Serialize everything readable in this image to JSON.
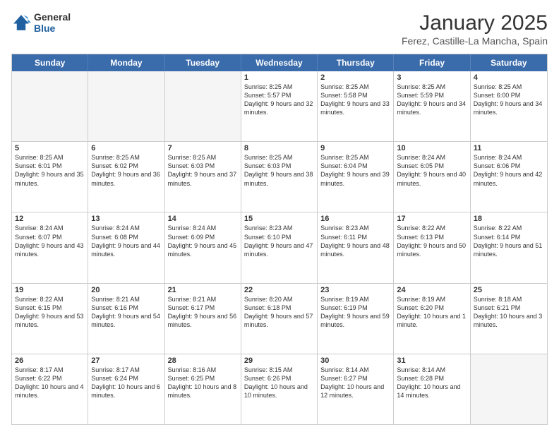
{
  "header": {
    "logo_general": "General",
    "logo_blue": "Blue",
    "month_title": "January 2025",
    "subtitle": "Ferez, Castille-La Mancha, Spain"
  },
  "days_of_week": [
    "Sunday",
    "Monday",
    "Tuesday",
    "Wednesday",
    "Thursday",
    "Friday",
    "Saturday"
  ],
  "rows": [
    [
      {
        "day": "",
        "sunrise": "",
        "sunset": "",
        "daylight": "",
        "empty": true
      },
      {
        "day": "",
        "sunrise": "",
        "sunset": "",
        "daylight": "",
        "empty": true
      },
      {
        "day": "",
        "sunrise": "",
        "sunset": "",
        "daylight": "",
        "empty": true
      },
      {
        "day": "1",
        "sunrise": "Sunrise: 8:25 AM",
        "sunset": "Sunset: 5:57 PM",
        "daylight": "Daylight: 9 hours and 32 minutes."
      },
      {
        "day": "2",
        "sunrise": "Sunrise: 8:25 AM",
        "sunset": "Sunset: 5:58 PM",
        "daylight": "Daylight: 9 hours and 33 minutes."
      },
      {
        "day": "3",
        "sunrise": "Sunrise: 8:25 AM",
        "sunset": "Sunset: 5:59 PM",
        "daylight": "Daylight: 9 hours and 34 minutes."
      },
      {
        "day": "4",
        "sunrise": "Sunrise: 8:25 AM",
        "sunset": "Sunset: 6:00 PM",
        "daylight": "Daylight: 9 hours and 34 minutes."
      }
    ],
    [
      {
        "day": "5",
        "sunrise": "Sunrise: 8:25 AM",
        "sunset": "Sunset: 6:01 PM",
        "daylight": "Daylight: 9 hours and 35 minutes."
      },
      {
        "day": "6",
        "sunrise": "Sunrise: 8:25 AM",
        "sunset": "Sunset: 6:02 PM",
        "daylight": "Daylight: 9 hours and 36 minutes."
      },
      {
        "day": "7",
        "sunrise": "Sunrise: 8:25 AM",
        "sunset": "Sunset: 6:03 PM",
        "daylight": "Daylight: 9 hours and 37 minutes."
      },
      {
        "day": "8",
        "sunrise": "Sunrise: 8:25 AM",
        "sunset": "Sunset: 6:03 PM",
        "daylight": "Daylight: 9 hours and 38 minutes."
      },
      {
        "day": "9",
        "sunrise": "Sunrise: 8:25 AM",
        "sunset": "Sunset: 6:04 PM",
        "daylight": "Daylight: 9 hours and 39 minutes."
      },
      {
        "day": "10",
        "sunrise": "Sunrise: 8:24 AM",
        "sunset": "Sunset: 6:05 PM",
        "daylight": "Daylight: 9 hours and 40 minutes."
      },
      {
        "day": "11",
        "sunrise": "Sunrise: 8:24 AM",
        "sunset": "Sunset: 6:06 PM",
        "daylight": "Daylight: 9 hours and 42 minutes."
      }
    ],
    [
      {
        "day": "12",
        "sunrise": "Sunrise: 8:24 AM",
        "sunset": "Sunset: 6:07 PM",
        "daylight": "Daylight: 9 hours and 43 minutes."
      },
      {
        "day": "13",
        "sunrise": "Sunrise: 8:24 AM",
        "sunset": "Sunset: 6:08 PM",
        "daylight": "Daylight: 9 hours and 44 minutes."
      },
      {
        "day": "14",
        "sunrise": "Sunrise: 8:24 AM",
        "sunset": "Sunset: 6:09 PM",
        "daylight": "Daylight: 9 hours and 45 minutes."
      },
      {
        "day": "15",
        "sunrise": "Sunrise: 8:23 AM",
        "sunset": "Sunset: 6:10 PM",
        "daylight": "Daylight: 9 hours and 47 minutes."
      },
      {
        "day": "16",
        "sunrise": "Sunrise: 8:23 AM",
        "sunset": "Sunset: 6:11 PM",
        "daylight": "Daylight: 9 hours and 48 minutes."
      },
      {
        "day": "17",
        "sunrise": "Sunrise: 8:22 AM",
        "sunset": "Sunset: 6:13 PM",
        "daylight": "Daylight: 9 hours and 50 minutes."
      },
      {
        "day": "18",
        "sunrise": "Sunrise: 8:22 AM",
        "sunset": "Sunset: 6:14 PM",
        "daylight": "Daylight: 9 hours and 51 minutes."
      }
    ],
    [
      {
        "day": "19",
        "sunrise": "Sunrise: 8:22 AM",
        "sunset": "Sunset: 6:15 PM",
        "daylight": "Daylight: 9 hours and 53 minutes."
      },
      {
        "day": "20",
        "sunrise": "Sunrise: 8:21 AM",
        "sunset": "Sunset: 6:16 PM",
        "daylight": "Daylight: 9 hours and 54 minutes."
      },
      {
        "day": "21",
        "sunrise": "Sunrise: 8:21 AM",
        "sunset": "Sunset: 6:17 PM",
        "daylight": "Daylight: 9 hours and 56 minutes."
      },
      {
        "day": "22",
        "sunrise": "Sunrise: 8:20 AM",
        "sunset": "Sunset: 6:18 PM",
        "daylight": "Daylight: 9 hours and 57 minutes."
      },
      {
        "day": "23",
        "sunrise": "Sunrise: 8:19 AM",
        "sunset": "Sunset: 6:19 PM",
        "daylight": "Daylight: 9 hours and 59 minutes."
      },
      {
        "day": "24",
        "sunrise": "Sunrise: 8:19 AM",
        "sunset": "Sunset: 6:20 PM",
        "daylight": "Daylight: 10 hours and 1 minute."
      },
      {
        "day": "25",
        "sunrise": "Sunrise: 8:18 AM",
        "sunset": "Sunset: 6:21 PM",
        "daylight": "Daylight: 10 hours and 3 minutes."
      }
    ],
    [
      {
        "day": "26",
        "sunrise": "Sunrise: 8:17 AM",
        "sunset": "Sunset: 6:22 PM",
        "daylight": "Daylight: 10 hours and 4 minutes."
      },
      {
        "day": "27",
        "sunrise": "Sunrise: 8:17 AM",
        "sunset": "Sunset: 6:24 PM",
        "daylight": "Daylight: 10 hours and 6 minutes."
      },
      {
        "day": "28",
        "sunrise": "Sunrise: 8:16 AM",
        "sunset": "Sunset: 6:25 PM",
        "daylight": "Daylight: 10 hours and 8 minutes."
      },
      {
        "day": "29",
        "sunrise": "Sunrise: 8:15 AM",
        "sunset": "Sunset: 6:26 PM",
        "daylight": "Daylight: 10 hours and 10 minutes."
      },
      {
        "day": "30",
        "sunrise": "Sunrise: 8:14 AM",
        "sunset": "Sunset: 6:27 PM",
        "daylight": "Daylight: 10 hours and 12 minutes."
      },
      {
        "day": "31",
        "sunrise": "Sunrise: 8:14 AM",
        "sunset": "Sunset: 6:28 PM",
        "daylight": "Daylight: 10 hours and 14 minutes."
      },
      {
        "day": "",
        "sunrise": "",
        "sunset": "",
        "daylight": "",
        "empty": true
      }
    ]
  ]
}
